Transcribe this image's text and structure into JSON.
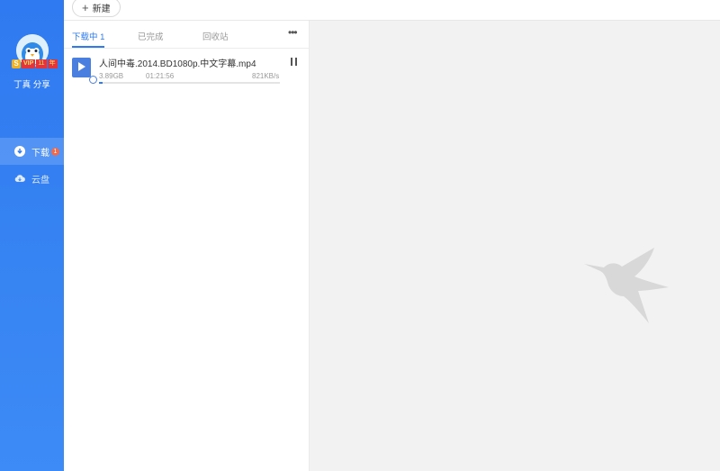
{
  "user": {
    "name": "丁真 分享",
    "badges": {
      "s": "S",
      "vip": "VIP",
      "level": "11",
      "extra": "年"
    }
  },
  "nav": [
    {
      "label": "下载",
      "count": "1",
      "icon": "download-icon",
      "active": true
    },
    {
      "label": "云盘",
      "icon": "cloud-icon",
      "active": false
    }
  ],
  "toolbar": {
    "new_label": "新建",
    "new_icon": "+"
  },
  "tabs": [
    {
      "label": "下载中 1",
      "active": true
    },
    {
      "label": "已完成",
      "active": false
    },
    {
      "label": "回收站",
      "active": false
    }
  ],
  "more_label": "•••",
  "tasks": [
    {
      "name": "人间中毒.2014.BD1080p.中文字幕.mp4",
      "size": "3.89GB",
      "time_left": "01:21:56",
      "speed": "821KB/s",
      "progress": 0.01,
      "file_icon": "video-file-icon"
    }
  ],
  "colors": {
    "accent": "#2f7af0",
    "sidebar": "#3784f3",
    "empty_bg": "#f2f2f2"
  }
}
